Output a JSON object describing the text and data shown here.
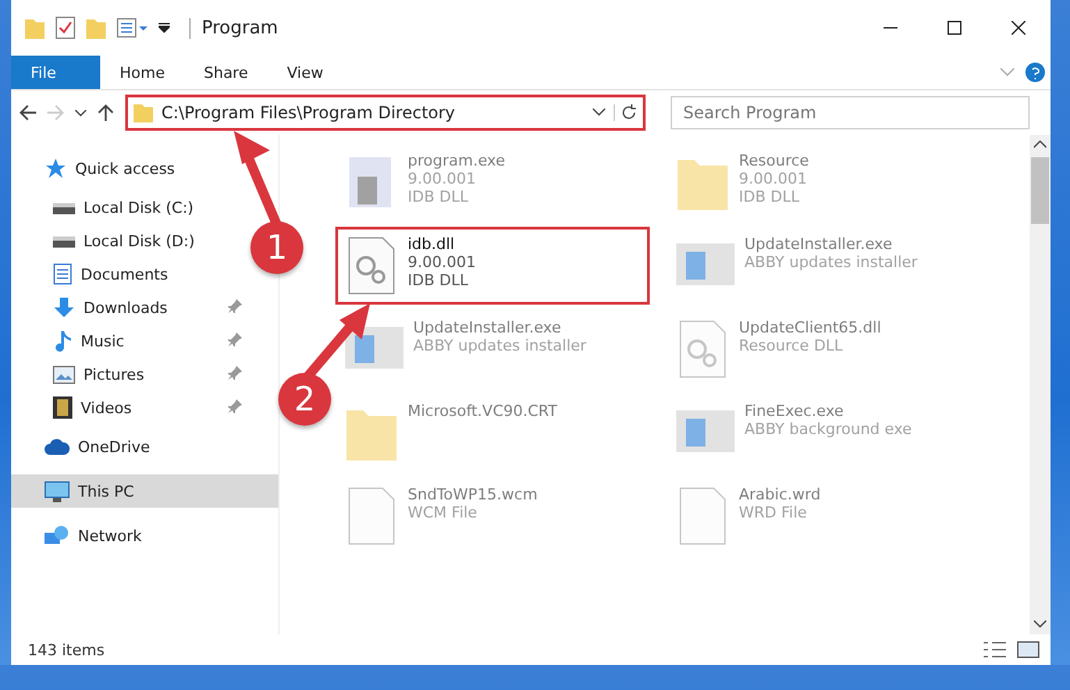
{
  "window": {
    "title": "Program"
  },
  "ribbon_tabs": [
    {
      "label": "File",
      "selected": true
    },
    {
      "label": "Home",
      "selected": false
    },
    {
      "label": "Share",
      "selected": false
    },
    {
      "label": "View",
      "selected": false
    }
  ],
  "address": {
    "path": "C:\\Program Files\\Program Directory",
    "highlighted": true
  },
  "search": {
    "placeholder": "Search Program"
  },
  "sidebar": {
    "items": [
      {
        "label": "Quick access",
        "kind": "star",
        "pinned": false,
        "selected": false,
        "children": [
          {
            "label": "Local Disk (C:)",
            "kind": "drive",
            "pinned": false,
            "selected": false
          },
          {
            "label": "Local Disk (D:)",
            "kind": "drive",
            "pinned": false,
            "selected": false
          },
          {
            "label": "Documents",
            "kind": "docs",
            "pinned": false,
            "selected": false
          },
          {
            "label": "Downloads",
            "kind": "download",
            "pinned": true,
            "selected": false
          },
          {
            "label": "Music",
            "kind": "music",
            "pinned": true,
            "selected": false
          },
          {
            "label": "Pictures",
            "kind": "pictures",
            "pinned": true,
            "selected": false
          },
          {
            "label": "Videos",
            "kind": "videos",
            "pinned": true,
            "selected": false
          }
        ]
      },
      {
        "label": "OneDrive",
        "kind": "cloud",
        "pinned": false,
        "selected": false
      },
      {
        "label": "This PC",
        "kind": "pc",
        "pinned": false,
        "selected": true
      },
      {
        "label": "Network",
        "kind": "network",
        "pinned": false,
        "selected": false
      }
    ]
  },
  "files": [
    {
      "name": "program.exe",
      "lines": [
        "9.00.001",
        "IDB DLL"
      ],
      "kind": "exe",
      "faded": true,
      "highlighted": false
    },
    {
      "name": "Resource",
      "lines": [
        "9.00.001",
        "IDB DLL"
      ],
      "kind": "folder",
      "faded": true,
      "highlighted": false
    },
    {
      "name": "idb.dll",
      "lines": [
        "9.00.001",
        "IDB DLL"
      ],
      "kind": "dll",
      "faded": false,
      "highlighted": true
    },
    {
      "name": "UpdateInstaller.exe",
      "lines": [
        "ABBY updates installer"
      ],
      "kind": "app",
      "faded": true,
      "highlighted": false
    },
    {
      "name": "UpdateInstaller.exe",
      "lines": [
        "ABBY updates installer"
      ],
      "kind": "app",
      "faded": true,
      "highlighted": false
    },
    {
      "name": "UpdateClient65.dll",
      "lines": [
        "Resource DLL"
      ],
      "kind": "dll",
      "faded": true,
      "highlighted": false
    },
    {
      "name": "Microsoft.VC90.CRT",
      "kind": "folder",
      "faded": true,
      "highlighted": false
    },
    {
      "name": "FineExec.exe",
      "lines": [
        "ABBY background exe"
      ],
      "kind": "app",
      "faded": true,
      "highlighted": false
    },
    {
      "name": "SndToWP15.wcm",
      "lines": [
        "WCM File"
      ],
      "kind": "file",
      "faded": true,
      "highlighted": false
    },
    {
      "name": "Arabic.wrd",
      "lines": [
        "WRD File"
      ],
      "kind": "file",
      "faded": true,
      "highlighted": false
    }
  ],
  "status_bar": {
    "count": "143 items"
  },
  "callouts": [
    {
      "number": "1"
    },
    {
      "number": "2"
    }
  ]
}
